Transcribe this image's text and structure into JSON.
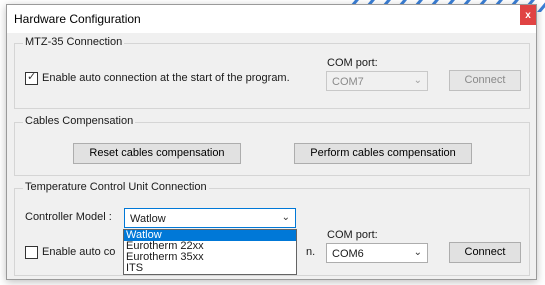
{
  "window": {
    "title": "Hardware Configuration",
    "close_label": "x"
  },
  "mtz": {
    "legend": "MTZ-35 Connection",
    "auto_checkbox": {
      "label": "Enable auto connection at the start of the program.",
      "checked": true
    },
    "com_label": "COM port:",
    "com_value": "COM7",
    "connect_label": "Connect"
  },
  "cables": {
    "legend": "Cables Compensation",
    "reset_label": "Reset cables compensation",
    "perform_label": "Perform cables compensation"
  },
  "tcu": {
    "legend": "Temperature Control Unit Connection",
    "model_label": "Controller Model :",
    "model_value": "Watlow",
    "model_options": [
      "Watlow",
      "Eurotherm 22xx",
      "Eurotherm 35xx",
      "ITS"
    ],
    "auto_checkbox_label_visible_start": "Enable auto co",
    "auto_checkbox_label_visible_end": "n.",
    "auto_checked": false,
    "com_label": "COM port:",
    "com_value": "COM6",
    "connect_label": "Connect"
  },
  "icons": {
    "checkmark": "check-icon",
    "dropdown": "chevron-down-icon"
  },
  "colors": {
    "accent": "#0078d7",
    "close": "#e04343",
    "stripes": "#3b7fd6"
  }
}
